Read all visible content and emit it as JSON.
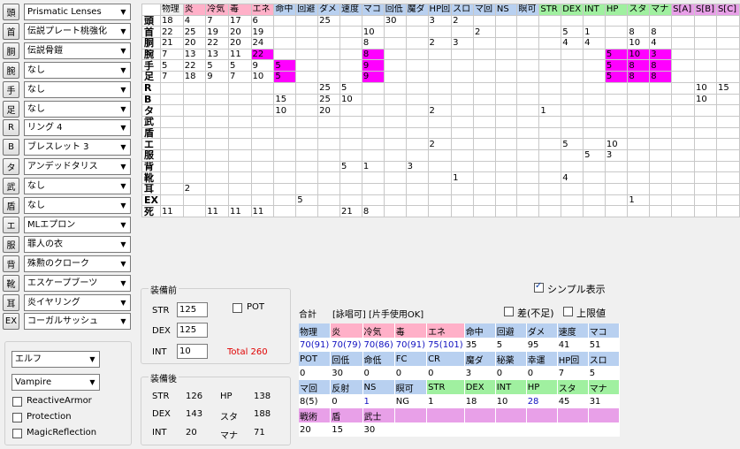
{
  "slots": [
    {
      "tag": "頭",
      "item": "Prismatic Lenses"
    },
    {
      "tag": "首",
      "item": "伝説プレート桃強化"
    },
    {
      "tag": "胴",
      "item": "伝説骨鎧"
    },
    {
      "tag": "腕",
      "item": "なし"
    },
    {
      "tag": "手",
      "item": "なし"
    },
    {
      "tag": "足",
      "item": "なし"
    },
    {
      "tag": "R",
      "item": "リング 4"
    },
    {
      "tag": "B",
      "item": "ブレスレット 3"
    },
    {
      "tag": "タ",
      "item": "アンデッドタリス"
    },
    {
      "tag": "武",
      "item": "なし"
    },
    {
      "tag": "盾",
      "item": "なし"
    },
    {
      "tag": "エ",
      "item": "MLエプロン"
    },
    {
      "tag": "服",
      "item": "罪人の衣"
    },
    {
      "tag": "背",
      "item": "殊勲のクローク"
    },
    {
      "tag": "靴",
      "item": "エスケープブーツ"
    },
    {
      "tag": "耳",
      "item": "炎イヤリング"
    },
    {
      "tag": "EX",
      "item": "コーガルサッシュ"
    }
  ],
  "grid_headers": [
    {
      "t": "物理",
      "c": "plain"
    },
    {
      "t": "炎",
      "c": "pink"
    },
    {
      "t": "冷気",
      "c": "pink"
    },
    {
      "t": "毒",
      "c": "pink"
    },
    {
      "t": "エネ",
      "c": "pink"
    },
    {
      "t": "命中",
      "c": "blue"
    },
    {
      "t": "回避",
      "c": "blue"
    },
    {
      "t": "ダメ",
      "c": "blue"
    },
    {
      "t": "速度",
      "c": "blue"
    },
    {
      "t": "マコ",
      "c": "blue"
    },
    {
      "t": "回低",
      "c": "blue"
    },
    {
      "t": "魔ダ",
      "c": "blue"
    },
    {
      "t": "HP回",
      "c": "blue"
    },
    {
      "t": "スロ",
      "c": "blue"
    },
    {
      "t": "マ回",
      "c": "blue"
    },
    {
      "t": "NS",
      "c": "blue"
    },
    {
      "t": "瞑可",
      "c": "blue"
    },
    {
      "t": "STR",
      "c": "green"
    },
    {
      "t": "DEX",
      "c": "green"
    },
    {
      "t": "INT",
      "c": "green"
    },
    {
      "t": "HP",
      "c": "green"
    },
    {
      "t": "スタ",
      "c": "green"
    },
    {
      "t": "マナ",
      "c": "green"
    },
    {
      "t": "S[A]",
      "c": "violet"
    },
    {
      "t": "S[B]",
      "c": "violet"
    },
    {
      "t": "S[C]",
      "c": "violet"
    }
  ],
  "grid_rows": [
    {
      "label": "頭",
      "cells": [
        "18",
        "4",
        "7",
        "17",
        "6",
        "",
        "",
        "25",
        "",
        "",
        "30",
        "",
        "3",
        "2",
        "",
        "",
        "",
        "",
        "",
        "",
        "",
        "",
        "",
        "",
        "",
        ""
      ]
    },
    {
      "label": "首",
      "cells": [
        "22",
        "25",
        "19",
        "20",
        "19",
        "",
        "",
        "",
        "",
        "10",
        "",
        "",
        "",
        "",
        "2",
        "",
        "",
        "",
        "5",
        "1",
        "",
        "8",
        "8",
        "",
        "",
        ""
      ]
    },
    {
      "label": "胴",
      "cells": [
        "21",
        "20",
        "22",
        "20",
        "24",
        "",
        "",
        "",
        "",
        "8",
        "",
        "",
        "2",
        "3",
        "",
        "",
        "",
        "",
        "4",
        "4",
        "",
        "10",
        "4",
        "",
        "",
        ""
      ]
    },
    {
      "label": "腕",
      "cells": [
        "7",
        "13",
        "13",
        "11",
        "22",
        "",
        "",
        "",
        "",
        "8",
        "",
        "",
        "",
        "",
        "",
        "",
        "",
        "",
        "",
        "",
        "5",
        "10",
        "3",
        "",
        "",
        ""
      ],
      "mg": [
        4,
        9,
        20,
        21,
        22
      ]
    },
    {
      "label": "手",
      "cells": [
        "5",
        "22",
        "5",
        "5",
        "9",
        "5",
        "",
        "",
        "",
        "9",
        "",
        "",
        "",
        "",
        "",
        "",
        "",
        "",
        "",
        "",
        "5",
        "8",
        "8",
        "",
        "",
        ""
      ],
      "mg": [
        5,
        9,
        20,
        21,
        22
      ]
    },
    {
      "label": "足",
      "cells": [
        "7",
        "18",
        "9",
        "7",
        "10",
        "5",
        "",
        "",
        "",
        "9",
        "",
        "",
        "",
        "",
        "",
        "",
        "",
        "",
        "",
        "",
        "5",
        "8",
        "8",
        "",
        "",
        ""
      ],
      "mg": [
        5,
        9,
        20,
        21,
        22
      ]
    },
    {
      "label": "R",
      "cells": [
        "",
        "",
        "",
        "",
        "",
        "",
        "",
        "25",
        "5",
        "",
        "",
        "",
        "",
        "",
        "",
        "",
        "",
        "",
        "",
        "",
        "",
        "",
        "",
        "",
        "10",
        "15"
      ]
    },
    {
      "label": "B",
      "cells": [
        "",
        "",
        "",
        "",
        "",
        "15",
        "",
        "25",
        "10",
        "",
        "",
        "",
        "",
        "",
        "",
        "",
        "",
        "",
        "",
        "",
        "",
        "",
        "",
        "",
        "10",
        ""
      ]
    },
    {
      "label": "タ",
      "cells": [
        "",
        "",
        "",
        "",
        "",
        "10",
        "",
        "20",
        "",
        "",
        "",
        "",
        "2",
        "",
        "",
        "",
        "",
        "1",
        "",
        "",
        "",
        "",
        "",
        "",
        "",
        ""
      ]
    },
    {
      "label": "武",
      "cells": [
        "",
        "",
        "",
        "",
        "",
        "",
        "",
        "",
        "",
        "",
        "",
        "",
        "",
        "",
        "",
        "",
        "",
        "",
        "",
        "",
        "",
        "",
        "",
        "",
        "",
        ""
      ]
    },
    {
      "label": "盾",
      "cells": [
        "",
        "",
        "",
        "",
        "",
        "",
        "",
        "",
        "",
        "",
        "",
        "",
        "",
        "",
        "",
        "",
        "",
        "",
        "",
        "",
        "",
        "",
        "",
        "",
        "",
        ""
      ]
    },
    {
      "label": "エ",
      "cells": [
        "",
        "",
        "",
        "",
        "",
        "",
        "",
        "",
        "",
        "",
        "",
        "",
        "2",
        "",
        "",
        "",
        "",
        "",
        "5",
        "",
        "10",
        "",
        "",
        "",
        "",
        ""
      ]
    },
    {
      "label": "服",
      "cells": [
        "",
        "",
        "",
        "",
        "",
        "",
        "",
        "",
        "",
        "",
        "",
        "",
        "",
        "",
        "",
        "",
        "",
        "",
        "",
        "5",
        "3",
        "",
        "",
        "",
        "",
        ""
      ]
    },
    {
      "label": "背",
      "cells": [
        "",
        "",
        "",
        "",
        "",
        "",
        "",
        "",
        "5",
        "1",
        "",
        "3",
        "",
        "",
        "",
        "",
        "",
        "",
        "",
        "",
        "",
        "",
        "",
        "",
        "",
        ""
      ]
    },
    {
      "label": "靴",
      "cells": [
        "",
        "",
        "",
        "",
        "",
        "",
        "",
        "",
        "",
        "",
        "",
        "",
        "",
        "1",
        "",
        "",
        "",
        "",
        "4",
        "",
        "",
        "",
        "",
        "",
        "",
        ""
      ]
    },
    {
      "label": "耳",
      "cells": [
        "",
        "2",
        "",
        "",
        "",
        "",
        "",
        "",
        "",
        "",
        "",
        "",
        "",
        "",
        "",
        "",
        "",
        "",
        "",
        "",
        "",
        "",
        "",
        "",
        "",
        ""
      ]
    },
    {
      "label": "EX",
      "cells": [
        "",
        "",
        "",
        "",
        "",
        "",
        "5",
        "",
        "",
        "",
        "",
        "",
        "",
        "",
        "",
        "",
        "",
        "",
        "",
        "",
        "",
        "1",
        "",
        "",
        "",
        ""
      ]
    },
    {
      "label": "死",
      "cells": [
        "11",
        "",
        "11",
        "11",
        "11",
        "",
        "",
        "",
        "21",
        "8",
        "",
        "",
        "",
        "",
        "",
        "",
        "",
        "",
        "",
        "",
        "",
        "",
        "",
        "",
        "",
        ""
      ]
    }
  ],
  "before": {
    "title": "装備前",
    "str_label": "STR",
    "str": "125",
    "dex_label": "DEX",
    "dex": "125",
    "int_label": "INT",
    "int": "10",
    "total": "Total 260",
    "pot_label": "POT"
  },
  "after": {
    "title": "装備後",
    "str_label": "STR",
    "str": "126",
    "dex_label": "DEX",
    "dex": "143",
    "int_label": "INT",
    "int": "20",
    "hp_label": "HP",
    "hp": "138",
    "sta_label": "スタ",
    "sta": "188",
    "mana_label": "マナ",
    "mana": "71"
  },
  "race": "エルフ",
  "vampire": "Vampire",
  "options": [
    "ReactiveArmor",
    "Protection",
    "MagicReflection"
  ],
  "summary": {
    "title": "合計",
    "mode": "[詠唱可] [片手使用OK]",
    "simple_label": "シンプル表示",
    "diff_label": "差(不足)",
    "cap_label": "上限値",
    "rows": [
      {
        "type": "h",
        "cells": [
          [
            "物理",
            "blue"
          ],
          [
            "炎",
            "pink"
          ],
          [
            "冷気",
            "pink"
          ],
          [
            "毒",
            "pink"
          ],
          [
            "エネ",
            "pink"
          ],
          [
            "命中",
            "blue"
          ],
          [
            "回避",
            "blue"
          ],
          [
            "ダメ",
            "blue"
          ],
          [
            "速度",
            "blue"
          ],
          [
            "マコ",
            "blue"
          ]
        ]
      },
      {
        "type": "v",
        "cells": [
          "70(91)",
          "70(79)",
          "70(86)",
          "70(91)",
          "75(101)",
          "35",
          "5",
          "95",
          "41",
          "51"
        ],
        "blue": [
          0,
          1,
          2,
          3,
          4
        ]
      },
      {
        "type": "h",
        "cells": [
          [
            "POT",
            "blue"
          ],
          [
            "回低",
            "blue"
          ],
          [
            "命低",
            "blue"
          ],
          [
            "FC",
            "blue"
          ],
          [
            "CR",
            "blue"
          ],
          [
            "魔ダ",
            "blue"
          ],
          [
            "秘薬",
            "blue"
          ],
          [
            "幸運",
            "blue"
          ],
          [
            "HP回",
            "blue"
          ],
          [
            "スロ",
            "blue"
          ]
        ]
      },
      {
        "type": "v",
        "cells": [
          "0",
          "30",
          "0",
          "0",
          "0",
          "3",
          "0",
          "0",
          "7",
          "5"
        ],
        "blue": []
      },
      {
        "type": "h",
        "cells": [
          [
            "マ回",
            "blue"
          ],
          [
            "反射",
            "blue"
          ],
          [
            "NS",
            "blue"
          ],
          [
            "瞑可",
            "blue"
          ],
          [
            "STR",
            "green"
          ],
          [
            "DEX",
            "green"
          ],
          [
            "INT",
            "green"
          ],
          [
            "HP",
            "green"
          ],
          [
            "スタ",
            "green"
          ],
          [
            "マナ",
            "green"
          ]
        ]
      },
      {
        "type": "v",
        "cells": [
          "8(5)",
          "0",
          "1",
          "NG",
          "1",
          "18",
          "10",
          "28",
          "45",
          "31"
        ],
        "blue": [
          2,
          7
        ]
      },
      {
        "type": "h",
        "cells": [
          [
            "戦術",
            "violet"
          ],
          [
            "盾",
            "violet"
          ],
          [
            "武士",
            "violet"
          ],
          [
            "",
            "violet"
          ],
          [
            "",
            "violet"
          ],
          [
            "",
            "violet"
          ],
          [
            "",
            "violet"
          ],
          [
            "",
            "violet"
          ],
          [
            "",
            "violet"
          ],
          [
            "",
            "violet"
          ]
        ]
      },
      {
        "type": "v",
        "cells": [
          "20",
          "15",
          "30",
          "",
          "",
          "",
          "",
          "",
          "",
          ""
        ],
        "blue": []
      }
    ]
  }
}
